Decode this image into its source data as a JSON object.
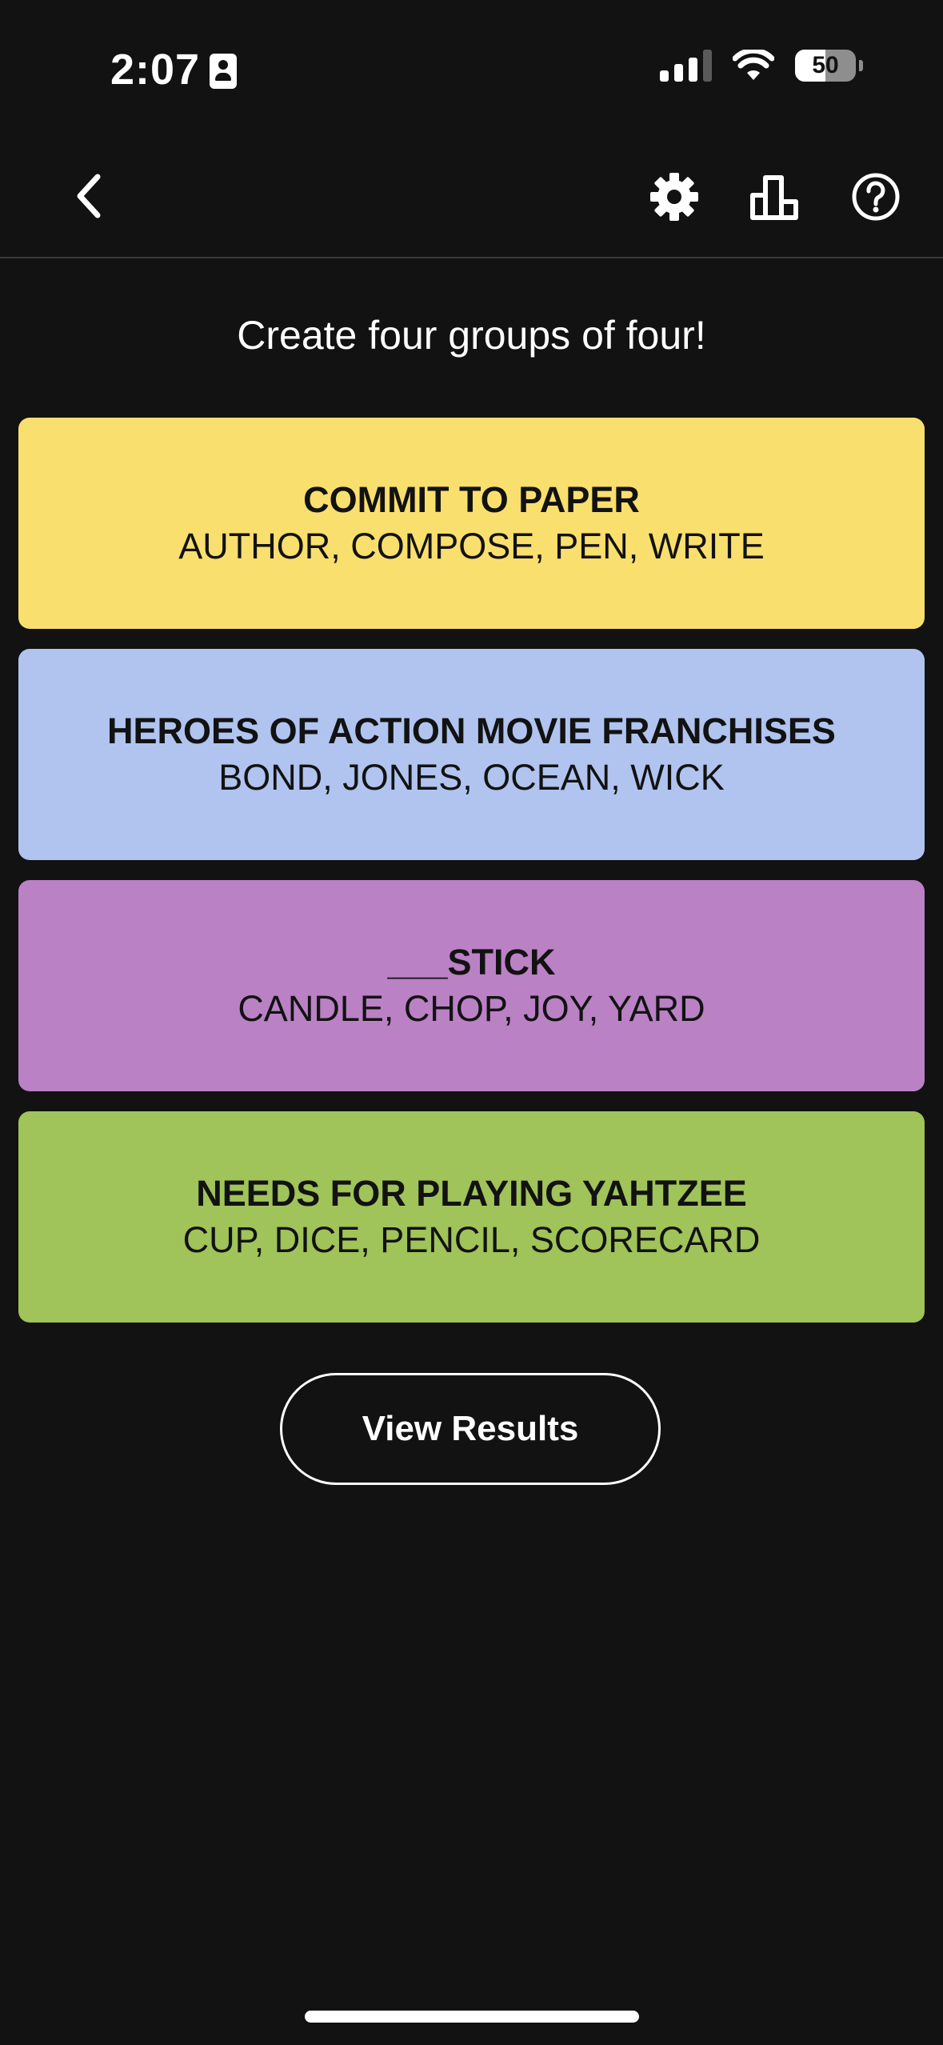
{
  "status_bar": {
    "time": "2:07",
    "battery": "50",
    "battery_level_percent": 50
  },
  "icons": {
    "back": "chevron-left",
    "settings": "gear",
    "stats": "bar-chart",
    "help": "question-circle"
  },
  "prompt": "Create four groups of four!",
  "groups": [
    {
      "title": "COMMIT TO PAPER",
      "words": "AUTHOR, COMPOSE, PEN, WRITE",
      "color": "#f9df6d"
    },
    {
      "title": "HEROES OF ACTION MOVIE FRANCHISES",
      "words": "BOND, JONES, OCEAN, WICK",
      "color": "#b0c4ef"
    },
    {
      "title": "___STICK",
      "words": "CANDLE, CHOP, JOY, YARD",
      "color": "#ba81c5"
    },
    {
      "title": "NEEDS FOR PLAYING YAHTZEE",
      "words": "CUP, DICE, PENCIL, SCORECARD",
      "color": "#a0c35a"
    }
  ],
  "view_results_label": "View Results",
  "colors": {
    "background": "#121212",
    "text": "#ffffff",
    "divider": "#3a3a3a"
  }
}
